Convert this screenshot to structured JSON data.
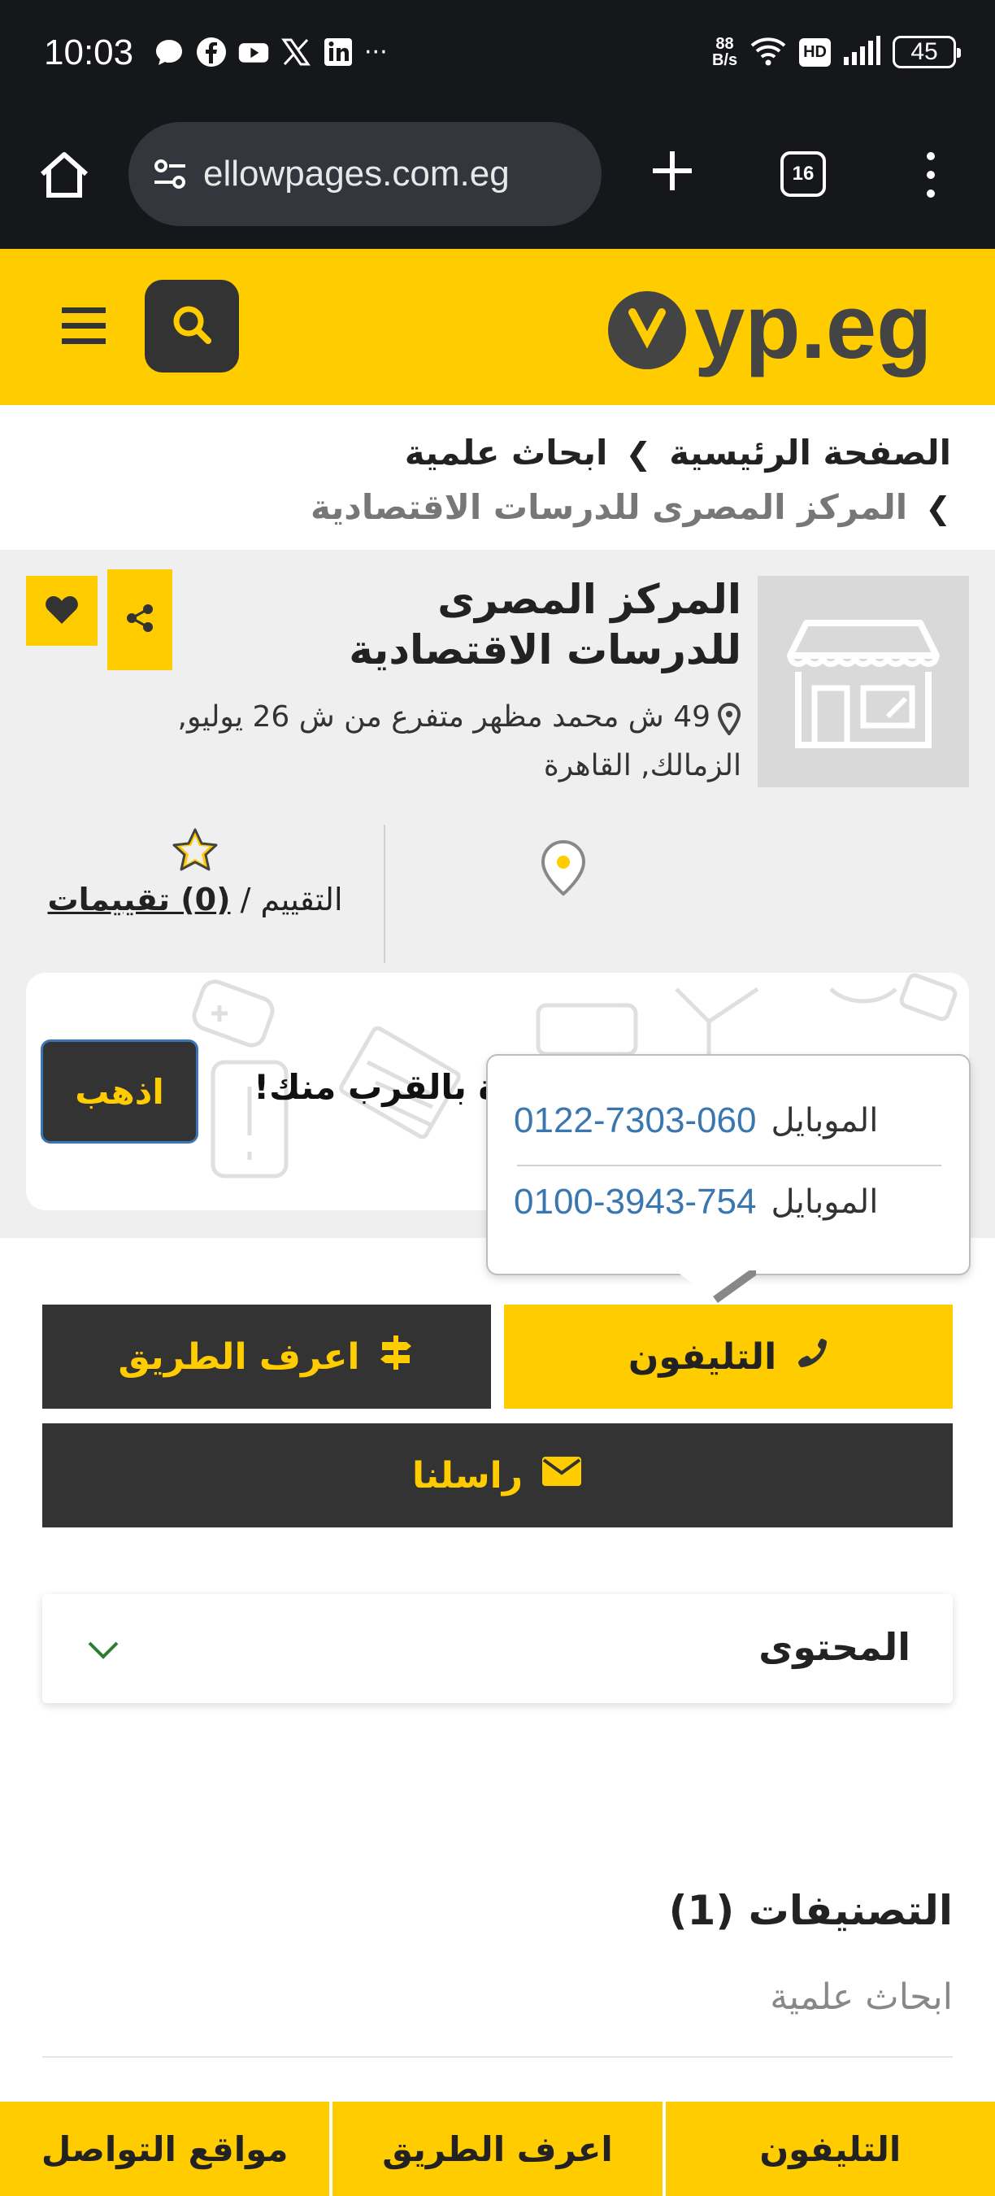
{
  "status_bar": {
    "time": "10:03",
    "net_speed_value": "88",
    "net_speed_unit": "B/s",
    "hd_badge": "HD",
    "battery": "45",
    "overflow": "···"
  },
  "browser": {
    "url": "ellowpages.com.eg",
    "tab_count": "16"
  },
  "header": {
    "logo_text": "yp.eg"
  },
  "breadcrumb": {
    "home": "الصفحة الرئيسية",
    "category": "ابحاث علمية",
    "current": "المركز المصرى للدرسات الاقتصادية"
  },
  "listing": {
    "name": "المركز المصرى للدرسات الاقتصادية",
    "address": "49 ش محمد مظهر متفرع من ش 26 يوليو, الزمالك, القاهرة",
    "rating_label": "التقييم /",
    "rating_count": "(0) تقييمات"
  },
  "nearby": {
    "text": "ة بالقرب منك!",
    "go_label": "اذهب"
  },
  "phone_popup": {
    "rows": [
      {
        "label": "الموبايل",
        "number": "0122-7303-060"
      },
      {
        "label": "الموبايل",
        "number": "0100-3943-754"
      }
    ]
  },
  "actions": {
    "phone": "التليفون",
    "directions": "اعرف الطريق",
    "message": "راسلنا"
  },
  "content_section": {
    "title": "المحتوى"
  },
  "categories": {
    "title": "التصنيفات (1)",
    "items": [
      "ابحاث علمية"
    ]
  },
  "bottom_bar": {
    "phone": "التليفون",
    "directions": "اعرف الطريق",
    "social": "مواقع التواصل"
  },
  "colors": {
    "brand_yellow": "#ffcc00",
    "dark": "#333333",
    "link_blue": "#3a77b0"
  }
}
